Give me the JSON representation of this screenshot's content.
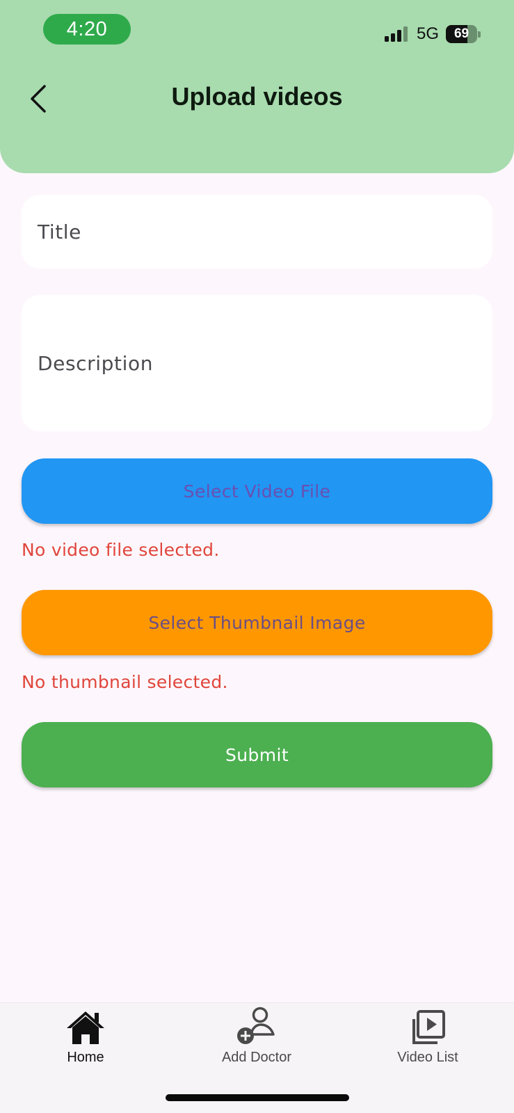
{
  "status_bar": {
    "time": "4:20",
    "network": "5G",
    "battery_level": "69",
    "battery_fraction": 0.69,
    "signal_bars": 3,
    "time_pill_color": "#2faa4b"
  },
  "header": {
    "title": "Upload videos",
    "background_color": "#a8dbae",
    "back_icon": "chevron-left-icon"
  },
  "form": {
    "title_placeholder": "Title",
    "description_placeholder": "Description",
    "select_video_label": "Select Video File",
    "video_status": "No video file selected.",
    "select_thumbnail_label": "Select Thumbnail Image",
    "thumbnail_status": "No thumbnail selected.",
    "submit_label": "Submit"
  },
  "colors": {
    "video_button": "#2196f3",
    "thumbnail_button": "#ff9800",
    "submit_button": "#4caf50",
    "error_text": "#e0453b"
  },
  "bottom_nav": {
    "items": [
      {
        "label": "Home",
        "icon": "home-icon",
        "active": true
      },
      {
        "label": "Add Doctor",
        "icon": "add-person-icon",
        "active": false
      },
      {
        "label": "Video List",
        "icon": "video-library-icon",
        "active": false
      }
    ]
  }
}
